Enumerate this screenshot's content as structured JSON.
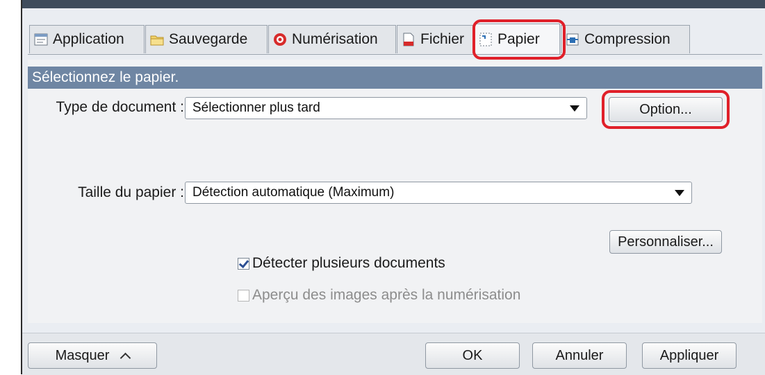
{
  "tabs": [
    {
      "label": "Application",
      "icon": "application-icon"
    },
    {
      "label": "Sauvegarde",
      "icon": "folder-icon"
    },
    {
      "label": "Numérisation",
      "icon": "scan-icon"
    },
    {
      "label": "Fichier",
      "icon": "file-icon"
    },
    {
      "label": "Papier",
      "icon": "paper-icon",
      "active": true
    },
    {
      "label": "Compression",
      "icon": "compression-icon"
    }
  ],
  "panel": {
    "header": "Sélectionnez le papier.",
    "doc_type_label": "Type de document :",
    "doc_type_value": "Sélectionner plus tard",
    "option_button": "Option...",
    "paper_size_label": "Taille du papier :",
    "paper_size_value": "Détection automatique (Maximum)",
    "customize_button": "Personnaliser...",
    "detect_multiple_label": "Détecter plusieurs documents",
    "detect_multiple_checked": true,
    "preview_label": "Aperçu des images après la numérisation",
    "preview_checked": false
  },
  "footer": {
    "hide_button": "Masquer",
    "ok_button": "OK",
    "cancel_button": "Annuler",
    "apply_button": "Appliquer"
  },
  "colors": {
    "header_bar": "#6f86a3",
    "highlight_ring": "#e0202a",
    "title_bar": "#3f4c5c"
  }
}
